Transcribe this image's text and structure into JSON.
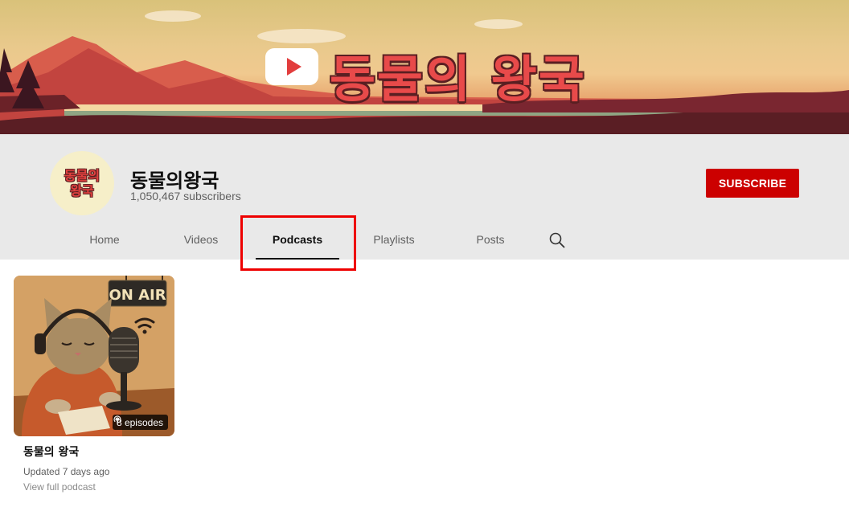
{
  "banner": {
    "title": "동물의 왕국"
  },
  "channel": {
    "avatar_line1": "동물의",
    "avatar_line2": "왕국",
    "name": "동물의왕국",
    "subscribers": "1,050,467 subscribers",
    "subscribe_label": "SUBSCRIBE"
  },
  "tabs": [
    {
      "label": "Home",
      "active": false
    },
    {
      "label": "Videos",
      "active": false
    },
    {
      "label": "Podcasts",
      "active": true
    },
    {
      "label": "Playlists",
      "active": false
    },
    {
      "label": "Posts",
      "active": false
    }
  ],
  "podcast": {
    "thumbnail_sign": "ON AIR",
    "episodes": "8 episodes",
    "title": "동물의 왕국",
    "updated": "Updated 7 days ago",
    "link": "View full podcast"
  },
  "colors": {
    "subscribe": "#cc0000",
    "highlight": "#ee0000",
    "header_bg": "#e9e9e9"
  },
  "icons": [
    "play-logo-icon",
    "search-icon",
    "podcast-icon"
  ]
}
